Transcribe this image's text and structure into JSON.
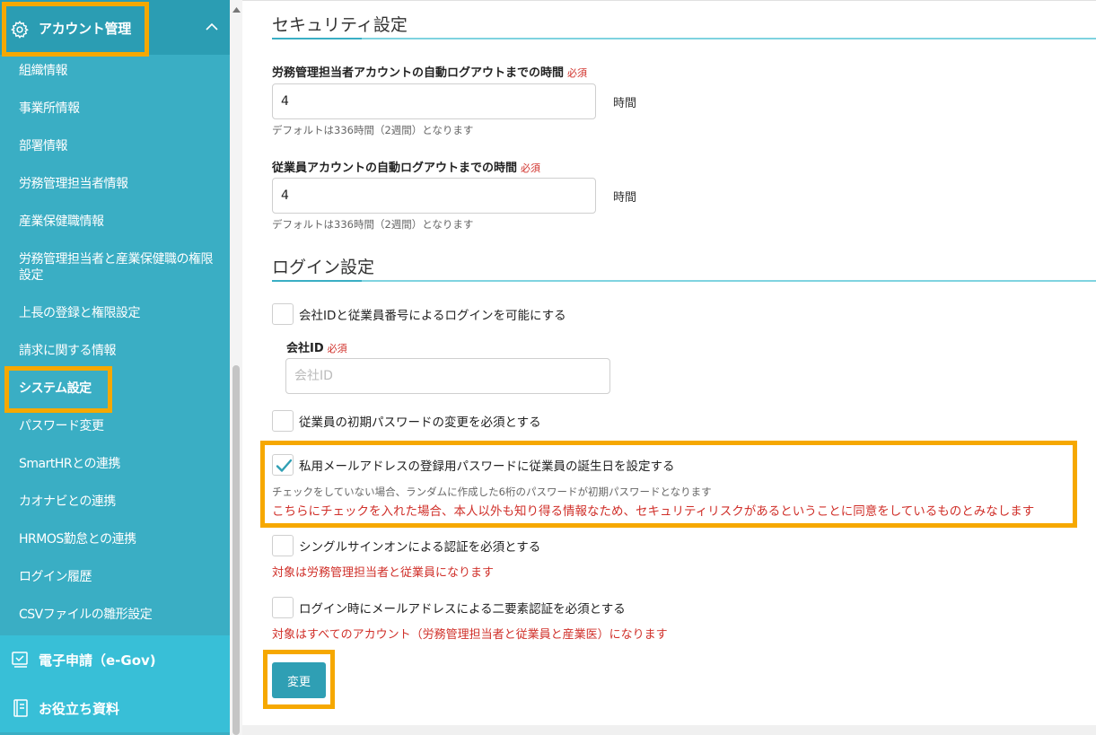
{
  "sidebar": {
    "header_title": "アカウント管理",
    "header_icon": "gear-icon",
    "items": [
      {
        "label": "組織情報"
      },
      {
        "label": "事業所情報"
      },
      {
        "label": "部署情報"
      },
      {
        "label": "労務管理担当者情報"
      },
      {
        "label": "産業保健職情報"
      },
      {
        "label": "労務管理担当者と産業保健職の権限設定"
      },
      {
        "label": "上長の登録と権限設定"
      },
      {
        "label": "請求に関する情報"
      },
      {
        "label": "システム設定",
        "active": true
      },
      {
        "label": "パスワード変更"
      },
      {
        "label": "SmartHRとの連携"
      },
      {
        "label": "カオナビとの連携"
      },
      {
        "label": "HRMOS勤怠との連携"
      },
      {
        "label": "ログイン履歴"
      },
      {
        "label": "CSVファイルの雛形設定"
      }
    ],
    "sections": [
      {
        "label": "電子申請（e-Gov)",
        "icon": "form-icon"
      },
      {
        "label": "お役立ち資料",
        "icon": "book-icon"
      }
    ]
  },
  "security": {
    "title": "セキュリティ設定",
    "admin_logout": {
      "label": "労務管理担当者アカウントの自動ログアウトまでの時間",
      "required": "必須",
      "value": "4",
      "unit": "時間",
      "hint": "デフォルトは336時間（2週間）となります"
    },
    "employee_logout": {
      "label": "従業員アカウントの自動ログアウトまでの時間",
      "required": "必須",
      "value": "4",
      "unit": "時間",
      "hint": "デフォルトは336時間（2週間）となります"
    }
  },
  "login": {
    "title": "ログイン設定",
    "company_id_login": {
      "label": "会社IDと従業員番号によるログインを可能にする",
      "checked": false
    },
    "company_id": {
      "label": "会社ID",
      "required": "必須",
      "value": "",
      "placeholder": "会社ID"
    },
    "initial_password": {
      "label": "従業員の初期パスワードの変更を必須とする",
      "checked": false
    },
    "birthday_password": {
      "label": "私用メールアドレスの登録用パスワードに従業員の誕生日を設定する",
      "checked": true,
      "hint": "チェックをしていない場合、ランダムに作成した6桁のパスワードが初期パスワードとなります",
      "warning": "こちらにチェックを入れた場合、本人以外も知り得る情報なため、セキュリティリスクがあるということに同意をしているものとみなします"
    },
    "sso": {
      "label": "シングルサインオンによる認証を必須とする",
      "checked": false,
      "note": "対象は労務管理担当者と従業員になります"
    },
    "two_factor": {
      "label": "ログイン時にメールアドレスによる二要素認証を必須とする",
      "checked": false,
      "note": "対象はすべてのアカウント（労務管理担当者と従業員と産業医）になります"
    }
  },
  "submit_label": "変更",
  "colors": {
    "sidebar_bg": "#3aaec4",
    "sidebar_header_bg": "#2b9db3",
    "highlight": "#f6a800",
    "accent": "#2f9fb4",
    "warning": "#d0302a"
  }
}
